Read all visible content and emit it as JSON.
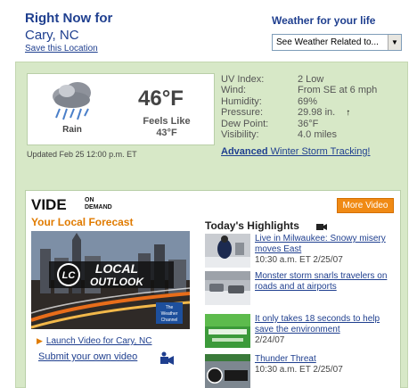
{
  "header": {
    "title": "Right Now for",
    "city": "Cary, NC",
    "save_link": "Save this Location",
    "life_title": "Weather for your life",
    "select_value": "See Weather Related to..."
  },
  "current": {
    "condition": "Rain",
    "temperature": "46°F",
    "feels_like_label": "Feels Like",
    "feels_like_value": "43°F",
    "icon": "rain-cloud-icon",
    "updated": "Updated Feb 25 12:00 p.m. ET"
  },
  "details": [
    {
      "label": "UV Index:",
      "value": "2 Low"
    },
    {
      "label": "Wind:",
      "value": "From SE at 6 mph"
    },
    {
      "label": "Humidity:",
      "value": "69%"
    },
    {
      "label": "Pressure:",
      "value": "29.98 in.",
      "trend": "↑"
    },
    {
      "label": "Dew Point:",
      "value": "36°F"
    },
    {
      "label": "Visibility:",
      "value": "4.0 miles"
    }
  ],
  "advanced": {
    "bold": "Advanced",
    "rest": " Winter Storm Tracking!"
  },
  "video": {
    "logo_left": "VIDE",
    "logo_on": "ON",
    "logo_demand": "DEMAND",
    "more_button": "More Video",
    "local_forecast_title": "Your Local Forecast",
    "thumb_lc": "LC",
    "thumb_line1": "LOCAL",
    "thumb_line2": "OUTLOOK",
    "thumb_brand1": "The",
    "thumb_brand2": "Weather",
    "thumb_brand3": "Channel",
    "launch_link": "Launch Video for Cary, NC",
    "submit_link": "Submit your own video"
  },
  "highlights": {
    "title": "Today's Highlights",
    "items": [
      {
        "title": "Live in Milwaukee: Snowy misery moves East",
        "time": "10:30 a.m. ET 2/25/07"
      },
      {
        "title": "Monster storm snarls travelers on roads and at airports",
        "time": ""
      },
      {
        "title": "It only takes 18 seconds to help save the environment",
        "time": "2/24/07"
      },
      {
        "title": "Thunder Threat",
        "time": "10:30 a.m. ET 2/25/07"
      }
    ]
  },
  "colors": {
    "brand_blue": "#1f3f8f",
    "panel_green": "#d7e8c7",
    "accent_orange": "#f08a14"
  }
}
